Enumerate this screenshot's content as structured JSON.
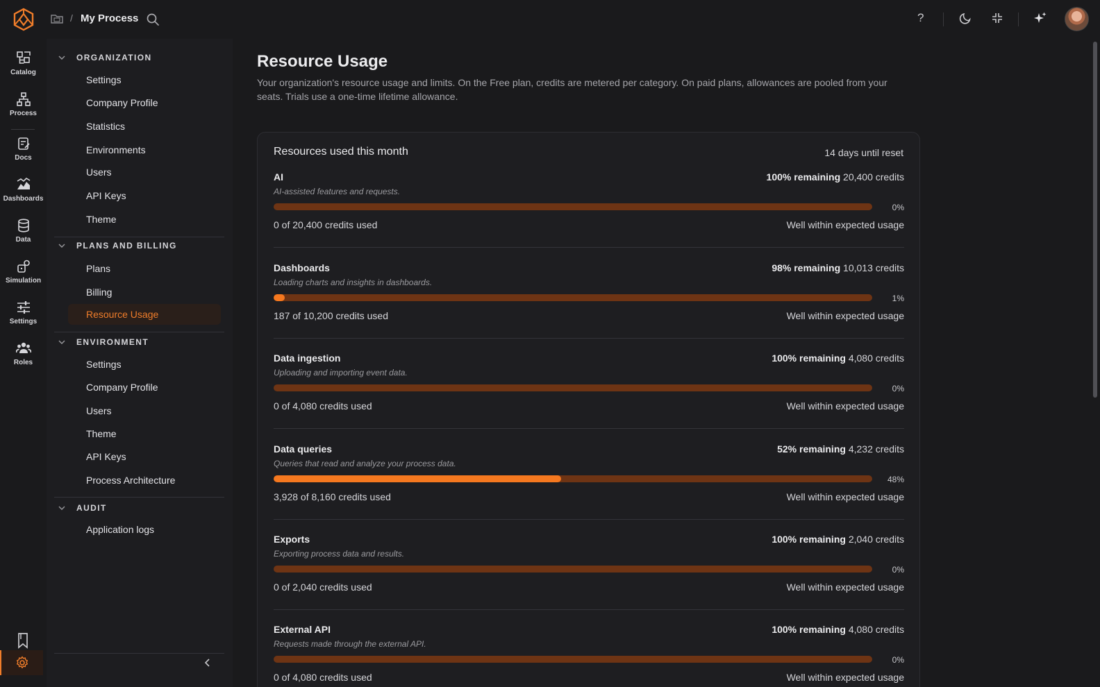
{
  "header": {
    "breadcrumb_separator": "/",
    "title": "My Process",
    "icons": [
      "folder-icon",
      "search-icon",
      "help-icon",
      "moon-icon",
      "collapse-icon",
      "sparkle-icon"
    ],
    "help_glyph": "?"
  },
  "rail": {
    "items": [
      {
        "label": "Catalog",
        "icon": "catalog-icon"
      },
      {
        "label": "Process",
        "icon": "process-icon"
      },
      {
        "label": "Docs",
        "icon": "docs-icon"
      },
      {
        "label": "Dashboards",
        "icon": "dashboards-icon"
      },
      {
        "label": "Data",
        "icon": "database-icon"
      },
      {
        "label": "Simulation",
        "icon": "simulation-icon"
      },
      {
        "label": "Settings",
        "icon": "sliders-icon"
      },
      {
        "label": "Roles",
        "icon": "users-icon"
      }
    ]
  },
  "nav": {
    "sections": [
      {
        "title": "ORGANIZATION",
        "items": [
          "Settings",
          "Company Profile",
          "Statistics",
          "Environments",
          "Users",
          "API Keys",
          "Theme"
        ]
      },
      {
        "title": "PLANS AND BILLING",
        "items": [
          "Plans",
          "Billing",
          "Resource Usage"
        ]
      },
      {
        "title": "ENVIRONMENT",
        "items": [
          "Settings",
          "Company Profile",
          "Users",
          "Theme",
          "API Keys",
          "Process Architecture"
        ]
      },
      {
        "title": "AUDIT",
        "items": [
          "Application logs"
        ]
      }
    ],
    "active_item": "Resource Usage"
  },
  "page": {
    "title": "Resource Usage",
    "description": "Your organization's resource usage and limits. On the Free plan, credits are metered per category. On paid plans, allowances are pooled from your seats. Trials use a one-time lifetime allowance."
  },
  "card": {
    "title": "Resources used this month",
    "reset": "14 days until reset",
    "resources": [
      {
        "name": "AI",
        "remaining_pct": "100% remaining",
        "remaining_credits": "20,400 credits",
        "description": "AI-assisted features and requests.",
        "used_fraction": 0.0,
        "pct_label": "0%",
        "used": "0 of 20,400 credits used",
        "status": "Well within expected usage"
      },
      {
        "name": "Dashboards",
        "remaining_pct": "98% remaining",
        "remaining_credits": "10,013 credits",
        "description": "Loading charts and insights in dashboards.",
        "used_fraction": 0.018,
        "pct_label": "1%",
        "used": "187 of 10,200 credits used",
        "status": "Well within expected usage"
      },
      {
        "name": "Data ingestion",
        "remaining_pct": "100% remaining",
        "remaining_credits": "4,080 credits",
        "description": "Uploading and importing event data.",
        "used_fraction": 0.0,
        "pct_label": "0%",
        "used": "0 of 4,080 credits used",
        "status": "Well within expected usage"
      },
      {
        "name": "Data queries",
        "remaining_pct": "52% remaining",
        "remaining_credits": "4,232 credits",
        "description": "Queries that read and analyze your process data.",
        "used_fraction": 0.48,
        "pct_label": "48%",
        "used": "3,928 of 8,160 credits used",
        "status": "Well within expected usage"
      },
      {
        "name": "Exports",
        "remaining_pct": "100% remaining",
        "remaining_credits": "2,040 credits",
        "description": "Exporting process data and results.",
        "used_fraction": 0.0,
        "pct_label": "0%",
        "used": "0 of 2,040 credits used",
        "status": "Well within expected usage"
      },
      {
        "name": "External API",
        "remaining_pct": "100% remaining",
        "remaining_credits": "4,080 credits",
        "description": "Requests made through the external API.",
        "used_fraction": 0.0,
        "pct_label": "0%",
        "used": "0 of 4,080 credits used",
        "status": "Well within expected usage"
      }
    ]
  },
  "colors": {
    "accent": "#f07d2a",
    "bar_track": "#6e3414",
    "bar_fill": "#f5781f",
    "background": "#1a1a1c"
  }
}
